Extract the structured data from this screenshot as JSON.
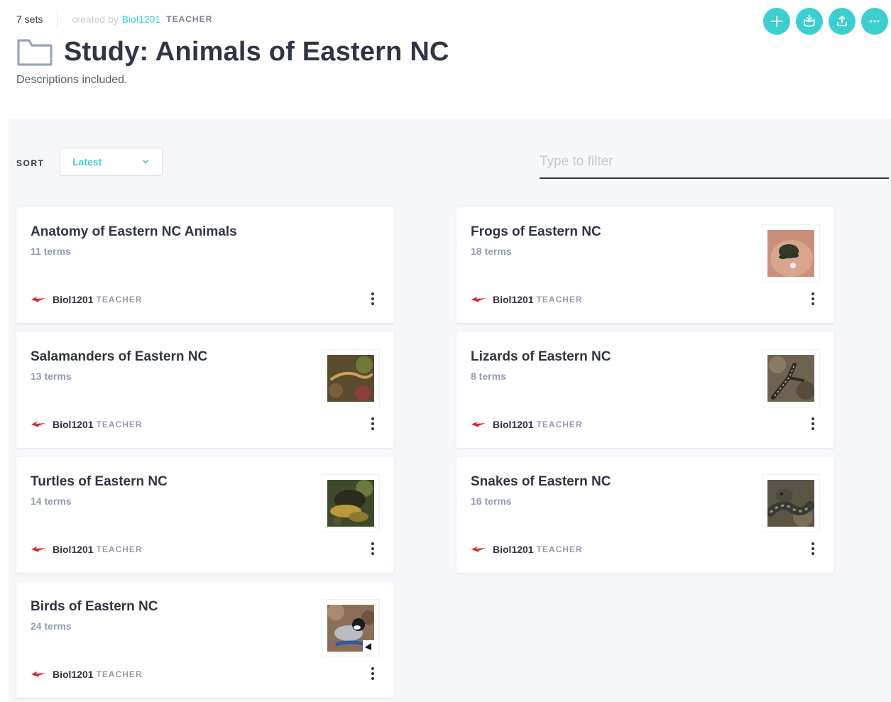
{
  "header": {
    "sets_count": "7 sets",
    "created_by": "created by",
    "creator": "Biol1201",
    "creator_role": "TEACHER",
    "title": "Study: Animals of Eastern NC",
    "description": "Descriptions included."
  },
  "actions": [
    {
      "icon": "plus-icon"
    },
    {
      "icon": "study-icon"
    },
    {
      "icon": "share-icon"
    },
    {
      "icon": "more-icon"
    }
  ],
  "controls": {
    "sort_label": "SORT",
    "sort_value": "Latest",
    "filter_placeholder": "Type to filter"
  },
  "colors": {
    "accent": "#3ccfcf",
    "text_dark": "#303545",
    "text_muted": "#939bb4",
    "background": "#f6f7fb"
  },
  "cards": [
    {
      "title": "Anatomy of Eastern NC Animals",
      "terms": "11 terms",
      "author": "Biol1201",
      "role": "TEACHER",
      "thumbnail": null
    },
    {
      "title": "Frogs of Eastern NC",
      "terms": "18 terms",
      "author": "Biol1201",
      "role": "TEACHER",
      "thumbnail": "frog-image"
    },
    {
      "title": "Salamanders of Eastern NC",
      "terms": "13 terms",
      "author": "Biol1201",
      "role": "TEACHER",
      "thumbnail": "salamander-image"
    },
    {
      "title": "Lizards of Eastern NC",
      "terms": "8 terms",
      "author": "Biol1201",
      "role": "TEACHER",
      "thumbnail": "lizard-image"
    },
    {
      "title": "Turtles of Eastern NC",
      "terms": "14 terms",
      "author": "Biol1201",
      "role": "TEACHER",
      "thumbnail": "turtle-image"
    },
    {
      "title": "Snakes of Eastern NC",
      "terms": "16 terms",
      "author": "Biol1201",
      "role": "TEACHER",
      "thumbnail": "snake-image"
    },
    {
      "title": "Birds of Eastern NC",
      "terms": "24 terms",
      "author": "Biol1201",
      "role": "TEACHER",
      "thumbnail": "bird-image"
    }
  ]
}
